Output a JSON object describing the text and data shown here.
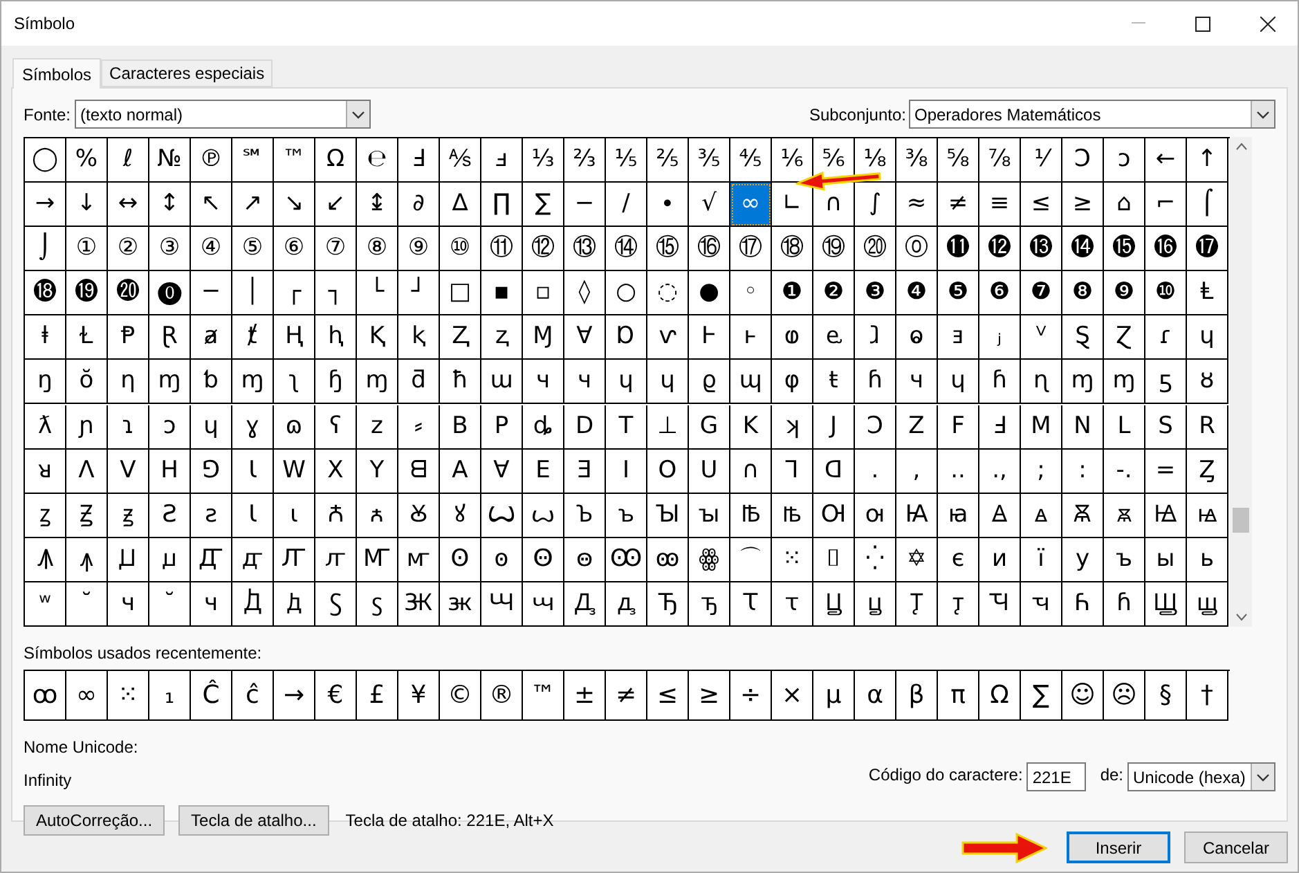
{
  "window": {
    "title": "Símbolo"
  },
  "tabs": [
    {
      "label": "Símbolos",
      "selected": true
    },
    {
      "label": "Caracteres especiais",
      "selected": false
    }
  ],
  "font": {
    "label": "Fonte:",
    "value": "(texto normal)"
  },
  "subset": {
    "label": "Subconjunto:",
    "value": "Operadores Matemáticos"
  },
  "symbol_grid": {
    "rows": [
      [
        {
          "symbol": "◯",
          "selected": false
        },
        {
          "symbol": "%",
          "selected": false
        },
        {
          "symbol": "ℓ",
          "selected": false
        },
        {
          "symbol": "№",
          "selected": false
        },
        {
          "symbol": "℗",
          "selected": false
        },
        {
          "symbol": "℠",
          "selected": false
        },
        {
          "symbol": "™",
          "selected": false
        },
        {
          "symbol": "Ω",
          "selected": false
        },
        {
          "symbol": "℮",
          "selected": false
        },
        {
          "symbol": "Ⅎ",
          "selected": false
        },
        {
          "symbol": "⅍",
          "selected": false
        },
        {
          "symbol": "ⅎ",
          "selected": false
        },
        {
          "symbol": "⅓",
          "selected": false
        },
        {
          "symbol": "⅔",
          "selected": false
        },
        {
          "symbol": "⅕",
          "selected": false
        },
        {
          "symbol": "⅖",
          "selected": false
        },
        {
          "symbol": "⅗",
          "selected": false
        },
        {
          "symbol": "⅘",
          "selected": false
        },
        {
          "symbol": "⅙",
          "selected": false
        },
        {
          "symbol": "⅚",
          "selected": false
        },
        {
          "symbol": "⅛",
          "selected": false
        },
        {
          "symbol": "⅜",
          "selected": false
        },
        {
          "symbol": "⅝",
          "selected": false
        },
        {
          "symbol": "⅞",
          "selected": false
        },
        {
          "symbol": "⅟",
          "selected": false
        },
        {
          "symbol": "Ↄ",
          "selected": false
        },
        {
          "symbol": "ↄ",
          "selected": false
        },
        {
          "symbol": "←",
          "selected": false
        },
        {
          "symbol": "↑",
          "selected": false
        }
      ],
      [
        {
          "symbol": "→",
          "selected": false
        },
        {
          "symbol": "↓",
          "selected": false
        },
        {
          "symbol": "↔",
          "selected": false
        },
        {
          "symbol": "↕",
          "selected": false
        },
        {
          "symbol": "↖",
          "selected": false
        },
        {
          "symbol": "↗",
          "selected": false
        },
        {
          "symbol": "↘",
          "selected": false
        },
        {
          "symbol": "↙",
          "selected": false
        },
        {
          "symbol": "↨",
          "selected": false
        },
        {
          "symbol": "∂",
          "selected": false
        },
        {
          "symbol": "∆",
          "selected": false
        },
        {
          "symbol": "∏",
          "selected": false
        },
        {
          "symbol": "∑",
          "selected": false
        },
        {
          "symbol": "−",
          "selected": false
        },
        {
          "symbol": "∕",
          "selected": false
        },
        {
          "symbol": "∙",
          "selected": false
        },
        {
          "symbol": "√",
          "selected": false
        },
        {
          "symbol": "∞",
          "selected": true
        },
        {
          "symbol": "∟",
          "selected": false
        },
        {
          "symbol": "∩",
          "selected": false
        },
        {
          "symbol": "∫",
          "selected": false
        },
        {
          "symbol": "≈",
          "selected": false
        },
        {
          "symbol": "≠",
          "selected": false
        },
        {
          "symbol": "≡",
          "selected": false
        },
        {
          "symbol": "≤",
          "selected": false
        },
        {
          "symbol": "≥",
          "selected": false
        },
        {
          "symbol": "⌂",
          "selected": false
        },
        {
          "symbol": "⌐",
          "selected": false
        },
        {
          "symbol": "⌠",
          "selected": false
        }
      ],
      [
        {
          "symbol": "⌡",
          "selected": false
        },
        {
          "symbol": "①",
          "selected": false
        },
        {
          "symbol": "②",
          "selected": false
        },
        {
          "symbol": "③",
          "selected": false
        },
        {
          "symbol": "④",
          "selected": false
        },
        {
          "symbol": "⑤",
          "selected": false
        },
        {
          "symbol": "⑥",
          "selected": false
        },
        {
          "symbol": "⑦",
          "selected": false
        },
        {
          "symbol": "⑧",
          "selected": false
        },
        {
          "symbol": "⑨",
          "selected": false
        },
        {
          "symbol": "⑩",
          "selected": false
        },
        {
          "symbol": "⑪",
          "selected": false
        },
        {
          "symbol": "⑫",
          "selected": false
        },
        {
          "symbol": "⑬",
          "selected": false
        },
        {
          "symbol": "⑭",
          "selected": false
        },
        {
          "symbol": "⑮",
          "selected": false
        },
        {
          "symbol": "⑯",
          "selected": false
        },
        {
          "symbol": "⑰",
          "selected": false
        },
        {
          "symbol": "⑱",
          "selected": false
        },
        {
          "symbol": "⑲",
          "selected": false
        },
        {
          "symbol": "⑳",
          "selected": false
        },
        {
          "symbol": "⓪",
          "selected": false
        },
        {
          "symbol": "⓫",
          "selected": false
        },
        {
          "symbol": "⓬",
          "selected": false
        },
        {
          "symbol": "⓭",
          "selected": false
        },
        {
          "symbol": "⓮",
          "selected": false
        },
        {
          "symbol": "⓯",
          "selected": false
        },
        {
          "symbol": "⓰",
          "selected": false
        },
        {
          "symbol": "⓱",
          "selected": false
        }
      ],
      [
        {
          "symbol": "⓲",
          "selected": false
        },
        {
          "symbol": "⓳",
          "selected": false
        },
        {
          "symbol": "⓴",
          "selected": false
        },
        {
          "symbol": "⓿",
          "selected": false
        },
        {
          "symbol": "─",
          "selected": false
        },
        {
          "symbol": "│",
          "selected": false
        },
        {
          "symbol": "┌",
          "selected": false
        },
        {
          "symbol": "┐",
          "selected": false
        },
        {
          "symbol": "└",
          "selected": false
        },
        {
          "symbol": "┘",
          "selected": false
        },
        {
          "symbol": "□",
          "selected": false
        },
        {
          "symbol": "▪",
          "selected": false
        },
        {
          "symbol": "▫",
          "selected": false
        },
        {
          "symbol": "◊",
          "selected": false
        },
        {
          "symbol": "○",
          "selected": false
        },
        {
          "symbol": "◌",
          "selected": false
        },
        {
          "symbol": "●",
          "selected": false
        },
        {
          "symbol": "◦",
          "selected": false
        },
        {
          "symbol": "❶",
          "selected": false
        },
        {
          "symbol": "❷",
          "selected": false
        },
        {
          "symbol": "❸",
          "selected": false
        },
        {
          "symbol": "❹",
          "selected": false
        },
        {
          "symbol": "❺",
          "selected": false
        },
        {
          "symbol": "❻",
          "selected": false
        },
        {
          "symbol": "❼",
          "selected": false
        },
        {
          "symbol": "❽",
          "selected": false
        },
        {
          "symbol": "❾",
          "selected": false
        },
        {
          "symbol": "❿",
          "selected": false
        },
        {
          "symbol": "Ⱡ",
          "selected": false
        }
      ],
      [
        {
          "symbol": "ⱡ",
          "selected": false
        },
        {
          "symbol": "Ɫ",
          "selected": false
        },
        {
          "symbol": "Ᵽ",
          "selected": false
        },
        {
          "symbol": "Ɽ",
          "selected": false
        },
        {
          "symbol": "ⱥ",
          "selected": false
        },
        {
          "symbol": "ⱦ",
          "selected": false
        },
        {
          "symbol": "Ⱨ",
          "selected": false
        },
        {
          "symbol": "ⱨ",
          "selected": false
        },
        {
          "symbol": "Ⱪ",
          "selected": false
        },
        {
          "symbol": "ⱪ",
          "selected": false
        },
        {
          "symbol": "Ⱬ",
          "selected": false
        },
        {
          "symbol": "ⱬ",
          "selected": false
        },
        {
          "symbol": "Ɱ",
          "selected": false
        },
        {
          "symbol": "Ɐ",
          "selected": false
        },
        {
          "symbol": "Ɒ",
          "selected": false
        },
        {
          "symbol": "ⱱ",
          "selected": false
        },
        {
          "symbol": "Ⱶ",
          "selected": false
        },
        {
          "symbol": "ⱶ",
          "selected": false
        },
        {
          "symbol": "ⱷ",
          "selected": false
        },
        {
          "symbol": "ⱸ",
          "selected": false
        },
        {
          "symbol": "ⱹ",
          "selected": false
        },
        {
          "symbol": "ⱺ",
          "selected": false
        },
        {
          "symbol": "ⱻ",
          "selected": false
        },
        {
          "symbol": "ⱼ",
          "selected": false
        },
        {
          "symbol": "ⱽ",
          "selected": false
        },
        {
          "symbol": "Ȿ",
          "selected": false
        },
        {
          "symbol": "Ɀ",
          "selected": false
        },
        {
          "symbol": "ɾ",
          "selected": false
        },
        {
          "symbol": "ɥ",
          "selected": false
        }
      ],
      [
        {
          "symbol": "ŋ",
          "selected": false
        },
        {
          "symbol": "ŏ",
          "selected": false
        },
        {
          "symbol": "η",
          "selected": false
        },
        {
          "symbol": "ɱ",
          "selected": false
        },
        {
          "symbol": "ƅ",
          "selected": false
        },
        {
          "symbol": "ɱ",
          "selected": false
        },
        {
          "symbol": "ʅ",
          "selected": false
        },
        {
          "symbol": "ɧ",
          "selected": false
        },
        {
          "symbol": "ɱ",
          "selected": false
        },
        {
          "symbol": "ƌ",
          "selected": false
        },
        {
          "symbol": "ħ",
          "selected": false
        },
        {
          "symbol": "ɯ",
          "selected": false
        },
        {
          "symbol": "ч",
          "selected": false
        },
        {
          "symbol": "ч",
          "selected": false
        },
        {
          "symbol": "ɥ",
          "selected": false
        },
        {
          "symbol": "ɥ",
          "selected": false
        },
        {
          "symbol": "ϱ",
          "selected": false
        },
        {
          "symbol": "ɰ",
          "selected": false
        },
        {
          "symbol": "φ",
          "selected": false
        },
        {
          "symbol": "ŧ",
          "selected": false
        },
        {
          "symbol": "ɦ",
          "selected": false
        },
        {
          "symbol": "ч",
          "selected": false
        },
        {
          "symbol": "ɥ",
          "selected": false
        },
        {
          "symbol": "ɦ",
          "selected": false
        },
        {
          "symbol": "ɳ",
          "selected": false
        },
        {
          "symbol": "ɱ",
          "selected": false
        },
        {
          "symbol": "ɱ",
          "selected": false
        },
        {
          "symbol": "ƽ",
          "selected": false
        },
        {
          "symbol": "ȣ",
          "selected": false
        }
      ],
      [
        {
          "symbol": "ƛ",
          "selected": false
        },
        {
          "symbol": "ɲ",
          "selected": false
        },
        {
          "symbol": "ɿ",
          "selected": false
        },
        {
          "symbol": "ɔ",
          "selected": false
        },
        {
          "symbol": "ɥ",
          "selected": false
        },
        {
          "symbol": "ɣ",
          "selected": false
        },
        {
          "symbol": "ɷ",
          "selected": false
        },
        {
          "symbol": "ʕ",
          "selected": false
        },
        {
          "symbol": "z",
          "selected": false
        },
        {
          "symbol": "⸗",
          "selected": false
        },
        {
          "symbol": "B",
          "selected": false
        },
        {
          "symbol": "P",
          "selected": false
        },
        {
          "symbol": "ȡ",
          "selected": false
        },
        {
          "symbol": "D",
          "selected": false
        },
        {
          "symbol": "T",
          "selected": false
        },
        {
          "symbol": "⊥",
          "selected": false
        },
        {
          "symbol": "G",
          "selected": false
        },
        {
          "symbol": "K",
          "selected": false
        },
        {
          "symbol": "ʞ",
          "selected": false
        },
        {
          "symbol": "J",
          "selected": false
        },
        {
          "symbol": "Ɔ",
          "selected": false
        },
        {
          "symbol": "Z",
          "selected": false
        },
        {
          "symbol": "F",
          "selected": false
        },
        {
          "symbol": "Ⅎ",
          "selected": false
        },
        {
          "symbol": "M",
          "selected": false
        },
        {
          "symbol": "N",
          "selected": false
        },
        {
          "symbol": "L",
          "selected": false
        },
        {
          "symbol": "S",
          "selected": false
        },
        {
          "symbol": "R",
          "selected": false
        }
      ],
      [
        {
          "symbol": "ᴚ",
          "selected": false
        },
        {
          "symbol": "Λ",
          "selected": false
        },
        {
          "symbol": "V",
          "selected": false
        },
        {
          "symbol": "H",
          "selected": false
        },
        {
          "symbol": "⅁",
          "selected": false
        },
        {
          "symbol": "Ɩ",
          "selected": false
        },
        {
          "symbol": "W",
          "selected": false
        },
        {
          "symbol": "X",
          "selected": false
        },
        {
          "symbol": "Y",
          "selected": false
        },
        {
          "symbol": "ᗺ",
          "selected": false
        },
        {
          "symbol": "A",
          "selected": false
        },
        {
          "symbol": "∀",
          "selected": false
        },
        {
          "symbol": "E",
          "selected": false
        },
        {
          "symbol": "Ǝ",
          "selected": false
        },
        {
          "symbol": "I",
          "selected": false
        },
        {
          "symbol": "O",
          "selected": false
        },
        {
          "symbol": "U",
          "selected": false
        },
        {
          "symbol": "∩",
          "selected": false
        },
        {
          "symbol": "⅂",
          "selected": false
        },
        {
          "symbol": "ᗡ",
          "selected": false
        },
        {
          "symbol": ".",
          "selected": false
        },
        {
          "symbol": ",",
          "selected": false
        },
        {
          "symbol": "..",
          "selected": false
        },
        {
          "symbol": ".,",
          "selected": false
        },
        {
          "symbol": ";",
          "selected": false
        },
        {
          "symbol": ":",
          "selected": false
        },
        {
          "symbol": "-.",
          "selected": false
        },
        {
          "symbol": "=",
          "selected": false
        },
        {
          "symbol": "Ȥ",
          "selected": false
        }
      ],
      [
        {
          "symbol": "ꙁ",
          "selected": false
        },
        {
          "symbol": "Ꙃ",
          "selected": false
        },
        {
          "symbol": "ꙃ",
          "selected": false
        },
        {
          "symbol": "Ꙅ",
          "selected": false
        },
        {
          "symbol": "ꙅ",
          "selected": false
        },
        {
          "symbol": "Ꙇ",
          "selected": false
        },
        {
          "symbol": "ꙇ",
          "selected": false
        },
        {
          "symbol": "Ꙉ",
          "selected": false
        },
        {
          "symbol": "ꙉ",
          "selected": false
        },
        {
          "symbol": "Ꙋ",
          "selected": false
        },
        {
          "symbol": "ꙋ",
          "selected": false
        },
        {
          "symbol": "Ꙍ",
          "selected": false
        },
        {
          "symbol": "ꙍ",
          "selected": false
        },
        {
          "symbol": "Ꙏ",
          "selected": false
        },
        {
          "symbol": "ꙏ",
          "selected": false
        },
        {
          "symbol": "Ꙑ",
          "selected": false
        },
        {
          "symbol": "ꙑ",
          "selected": false
        },
        {
          "symbol": "Ꙓ",
          "selected": false
        },
        {
          "symbol": "ꙓ",
          "selected": false
        },
        {
          "symbol": "Ꙕ",
          "selected": false
        },
        {
          "symbol": "ꙕ",
          "selected": false
        },
        {
          "symbol": "Ꙗ",
          "selected": false
        },
        {
          "symbol": "ꙗ",
          "selected": false
        },
        {
          "symbol": "Ꙙ",
          "selected": false
        },
        {
          "symbol": "ꙙ",
          "selected": false
        },
        {
          "symbol": "Ꙛ",
          "selected": false
        },
        {
          "symbol": "ꙛ",
          "selected": false
        },
        {
          "symbol": "Ꙝ",
          "selected": false
        },
        {
          "symbol": "ꙝ",
          "selected": false
        }
      ],
      [
        {
          "symbol": "Ꙟ",
          "selected": false
        },
        {
          "symbol": "ꙟ",
          "selected": false
        },
        {
          "symbol": "Ꙡ",
          "selected": false
        },
        {
          "symbol": "ꙡ",
          "selected": false
        },
        {
          "symbol": "Ꙣ",
          "selected": false
        },
        {
          "symbol": "ꙣ",
          "selected": false
        },
        {
          "symbol": "Ꙥ",
          "selected": false
        },
        {
          "symbol": "ꙥ",
          "selected": false
        },
        {
          "symbol": "Ꙧ",
          "selected": false
        },
        {
          "symbol": "ꙧ",
          "selected": false
        },
        {
          "symbol": "Ꙩ",
          "selected": false
        },
        {
          "symbol": "ꙩ",
          "selected": false
        },
        {
          "symbol": "Ꙫ",
          "selected": false
        },
        {
          "symbol": "ꙫ",
          "selected": false
        },
        {
          "symbol": "Ꙭ",
          "selected": false
        },
        {
          "symbol": "ꙭ",
          "selected": false
        },
        {
          "symbol": "ꙮ",
          "selected": false
        },
        {
          "symbol": "⌒",
          "selected": false
        },
        {
          "symbol": "⁙",
          "selected": false
        },
        {
          "symbol": "⌷",
          "selected": false
        },
        {
          "symbol": "⁛",
          "selected": false
        },
        {
          "symbol": "✡",
          "selected": false
        },
        {
          "symbol": "є",
          "selected": false
        },
        {
          "symbol": "и",
          "selected": false
        },
        {
          "symbol": "ї",
          "selected": false
        },
        {
          "symbol": "у",
          "selected": false
        },
        {
          "symbol": "ъ",
          "selected": false
        },
        {
          "symbol": "ы",
          "selected": false
        },
        {
          "symbol": "ь",
          "selected": false
        }
      ],
      [
        {
          "symbol": "ʷ",
          "selected": false
        },
        {
          "symbol": "˘",
          "selected": false
        },
        {
          "symbol": "ч",
          "selected": false
        },
        {
          "symbol": "˘",
          "selected": false
        },
        {
          "symbol": "ч",
          "selected": false
        },
        {
          "symbol": "Ꚁ",
          "selected": false
        },
        {
          "symbol": "ꚁ",
          "selected": false
        },
        {
          "symbol": "Ꚃ",
          "selected": false
        },
        {
          "symbol": "ꚃ",
          "selected": false
        },
        {
          "symbol": "Ꚅ",
          "selected": false
        },
        {
          "symbol": "ꚅ",
          "selected": false
        },
        {
          "symbol": "Ꚇ",
          "selected": false
        },
        {
          "symbol": "ꚇ",
          "selected": false
        },
        {
          "symbol": "Ꚉ",
          "selected": false
        },
        {
          "symbol": "ꚉ",
          "selected": false
        },
        {
          "symbol": "Ꚋ",
          "selected": false
        },
        {
          "symbol": "ꚋ",
          "selected": false
        },
        {
          "symbol": "Ꚍ",
          "selected": false
        },
        {
          "symbol": "ꚍ",
          "selected": false
        },
        {
          "symbol": "Ꚏ",
          "selected": false
        },
        {
          "symbol": "ꚏ",
          "selected": false
        },
        {
          "symbol": "Ꚑ",
          "selected": false
        },
        {
          "symbol": "ꚑ",
          "selected": false
        },
        {
          "symbol": "Ꚓ",
          "selected": false
        },
        {
          "symbol": "ꚓ",
          "selected": false
        },
        {
          "symbol": "Ꚕ",
          "selected": false
        },
        {
          "symbol": "ꚕ",
          "selected": false
        },
        {
          "symbol": "Ꚗ",
          "selected": false
        },
        {
          "symbol": "ꚗ",
          "selected": false
        }
      ]
    ]
  },
  "recent": {
    "label": "Símbolos usados recentemente:",
    "symbols": [
      "ꝏ",
      "∞",
      "⁙",
      "₁",
      "Ĉ",
      "ĉ",
      "→",
      "€",
      "£",
      "¥",
      "©",
      "®",
      "™",
      "±",
      "≠",
      "≤",
      "≥",
      "÷",
      "×",
      "µ",
      "α",
      "β",
      "π",
      "Ω",
      "∑",
      "☺",
      "☹",
      "§",
      "†"
    ]
  },
  "unicode_name": {
    "label": "Nome Unicode:",
    "value": "Infinity"
  },
  "char_code": {
    "label": "Código do caractere:",
    "value": "221E",
    "from_label": "de:",
    "from_value": "Unicode (hexa)"
  },
  "action_buttons": [
    "AutoCorreção...",
    "Tecla de atalho..."
  ],
  "shortcut_text": "Tecla de atalho: 221E, Alt+X",
  "dialog_buttons": [
    {
      "label": "Inserir",
      "default": true
    },
    {
      "label": "Cancelar",
      "default": false
    }
  ]
}
